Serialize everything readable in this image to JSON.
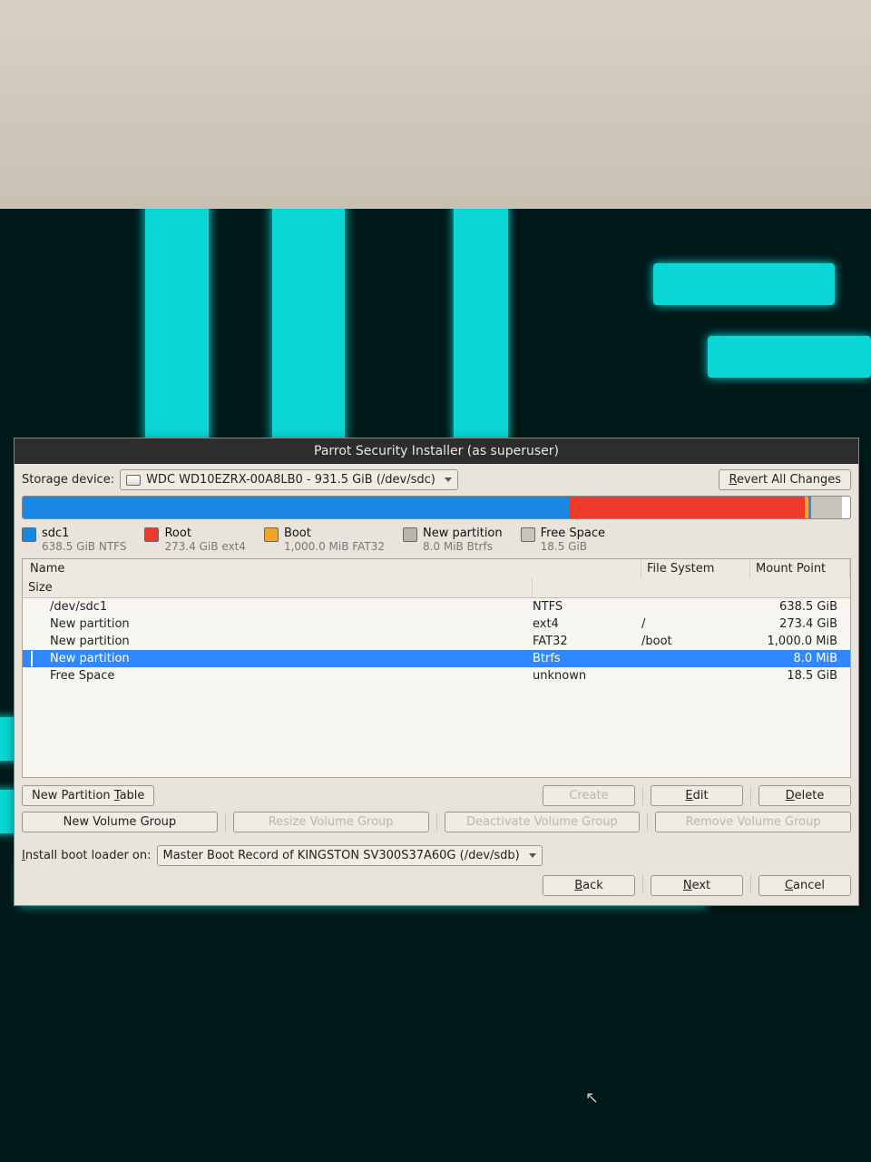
{
  "window": {
    "title": "Parrot Security Installer (as superuser)"
  },
  "storage": {
    "label": "Storage device:",
    "selected": "WDC WD10EZRX-00A8LB0 - 931.5 GiB (/dev/sdc)"
  },
  "buttons": {
    "revert": "Revert All Changes",
    "newPartTable": "New Partition Table",
    "create": "Create",
    "edit": "Edit",
    "delete": "Delete",
    "newVG": "New Volume Group",
    "resizeVG": "Resize Volume Group",
    "deactivateVG": "Deactivate Volume Group",
    "removeVG": "Remove Volume Group",
    "back": "Back",
    "next": "Next",
    "cancel": "Cancel"
  },
  "legend": [
    {
      "color": "blue",
      "name": "sdc1",
      "detail": "638.5 GiB  NTFS"
    },
    {
      "color": "red",
      "name": "Root",
      "detail": "273.4 GiB  ext4"
    },
    {
      "color": "orange",
      "name": "Boot",
      "detail": "1,000.0 MiB  FAT32"
    },
    {
      "color": "grey",
      "name": "New partition",
      "detail": "8.0 MiB  Btrfs"
    },
    {
      "color": "lgrey",
      "name": "Free Space",
      "detail": "18.5 GiB"
    }
  ],
  "columns": {
    "name": "Name",
    "fs": "File System",
    "mount": "Mount Point",
    "size": "Size"
  },
  "rows": [
    {
      "color": "#1b87e5",
      "name": "/dev/sdc1",
      "fs": "NTFS",
      "mount": "",
      "size": "638.5 GiB",
      "selected": false
    },
    {
      "color": "#ee3a2c",
      "name": "New partition",
      "fs": "ext4",
      "mount": "/",
      "size": "273.4 GiB",
      "selected": false
    },
    {
      "color": "#f2a428",
      "name": "New partition",
      "fs": "FAT32",
      "mount": "/boot",
      "size": "1,000.0 MiB",
      "selected": false
    },
    {
      "color": "#b8b4ac",
      "name": "New partition",
      "fs": "Btrfs",
      "mount": "",
      "size": "8.0 MiB",
      "selected": true
    },
    {
      "color": "#c8c4bc",
      "name": "Free Space",
      "fs": "unknown",
      "mount": "",
      "size": "18.5 GiB",
      "selected": false
    }
  ],
  "bootloader": {
    "label": "Install boot loader on:",
    "selected": "Master Boot Record of KINGSTON SV300S37A60G (/dev/sdb)"
  },
  "bar": {
    "blue": 66,
    "red": 28.5,
    "grey": 3.8
  }
}
